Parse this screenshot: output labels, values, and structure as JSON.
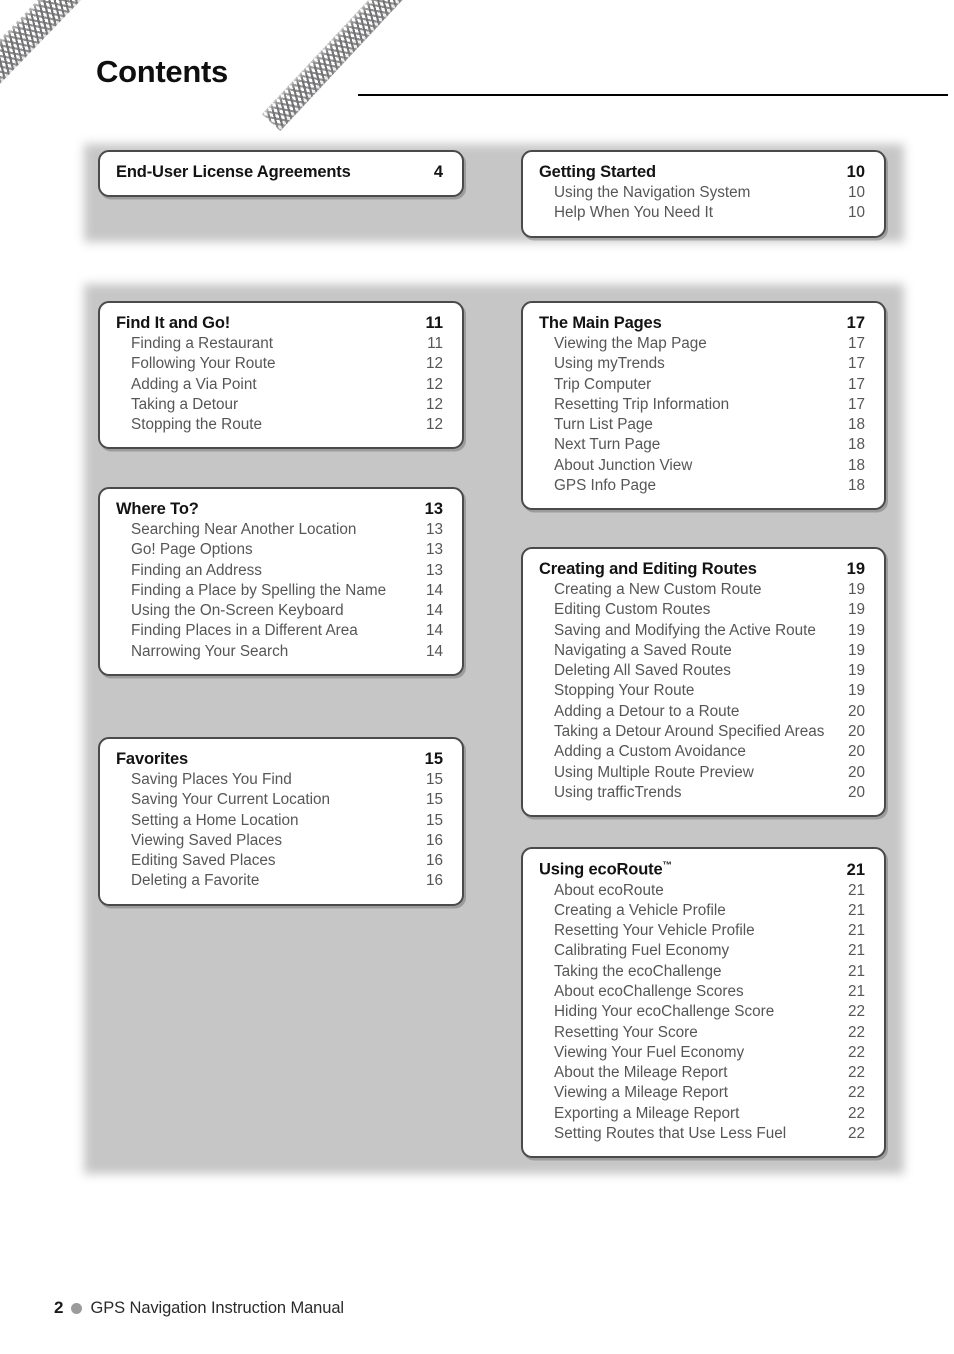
{
  "page": {
    "title": "Contents",
    "footer": {
      "page_number": "2",
      "manual_name": "GPS Navigation Instruction Manual"
    },
    "colors": {
      "panel_gray": "#c6c6c6",
      "box_border": "#4a4a4a",
      "heading_text": "#131313",
      "entry_text": "#565656",
      "footer_dot": "#9b9b9b"
    }
  },
  "toc": {
    "left_column": [
      {
        "heading": "End-User License Agreements",
        "page": "4",
        "entries": []
      },
      {
        "heading": "Find It and Go!",
        "page": "11",
        "entries": [
          {
            "label": "Finding a Restaurant",
            "page": "11"
          },
          {
            "label": "Following Your Route",
            "page": "12"
          },
          {
            "label": "Adding a Via Point",
            "page": "12"
          },
          {
            "label": "Taking a Detour",
            "page": "12"
          },
          {
            "label": "Stopping the Route",
            "page": "12"
          }
        ]
      },
      {
        "heading": "Where To?",
        "page": "13",
        "entries": [
          {
            "label": "Searching Near Another Location",
            "page": "13"
          },
          {
            "label": "Go! Page Options",
            "page": "13"
          },
          {
            "label": "Finding an Address",
            "page": "13"
          },
          {
            "label": "Finding a Place by Spelling the Name",
            "page": "14"
          },
          {
            "label": "Using the On-Screen Keyboard",
            "page": "14"
          },
          {
            "label": "Finding Places in a Different Area",
            "page": "14"
          },
          {
            "label": "Narrowing Your Search",
            "page": "14"
          }
        ]
      },
      {
        "heading": "Favorites",
        "page": "15",
        "entries": [
          {
            "label": "Saving Places You Find",
            "page": "15"
          },
          {
            "label": "Saving Your Current Location",
            "page": "15"
          },
          {
            "label": "Setting a Home Location",
            "page": "15"
          },
          {
            "label": "Viewing Saved Places",
            "page": "16"
          },
          {
            "label": "Editing Saved Places",
            "page": "16"
          },
          {
            "label": "Deleting a Favorite",
            "page": "16"
          }
        ]
      }
    ],
    "right_column": [
      {
        "heading": "Getting Started",
        "page": "10",
        "entries": [
          {
            "label": "Using the Navigation System",
            "page": "10"
          },
          {
            "label": "Help When You Need It",
            "page": "10"
          }
        ]
      },
      {
        "heading": "The Main Pages",
        "page": "17",
        "entries": [
          {
            "label": "Viewing the Map Page",
            "page": "17"
          },
          {
            "label": "Using myTrends",
            "page": "17"
          },
          {
            "label": "Trip Computer",
            "page": "17"
          },
          {
            "label": "Resetting Trip Information",
            "page": "17"
          },
          {
            "label": "Turn List Page",
            "page": "18"
          },
          {
            "label": "Next Turn Page",
            "page": "18"
          },
          {
            "label": "About Junction View",
            "page": "18"
          },
          {
            "label": "GPS Info Page",
            "page": "18"
          }
        ]
      },
      {
        "heading": "Creating and Editing Routes",
        "page": "19",
        "entries": [
          {
            "label": "Creating a New Custom Route",
            "page": "19"
          },
          {
            "label": "Editing Custom Routes",
            "page": "19"
          },
          {
            "label": "Saving and Modifying the Active Route",
            "page": "19"
          },
          {
            "label": "Navigating a Saved Route",
            "page": "19"
          },
          {
            "label": "Deleting All Saved Routes",
            "page": "19"
          },
          {
            "label": "Stopping Your Route",
            "page": "19"
          },
          {
            "label": "Adding a Detour to a Route",
            "page": "20"
          },
          {
            "label": "Taking a Detour Around Specified Areas",
            "page": "20"
          },
          {
            "label": "Adding a Custom Avoidance",
            "page": "20"
          },
          {
            "label": "Using Multiple Route Preview",
            "page": "20"
          },
          {
            "label": "Using trafficTrends",
            "page": "20"
          }
        ]
      },
      {
        "heading": "Using ecoRoute",
        "heading_superscript": "™",
        "page": "21",
        "entries": [
          {
            "label": "About ecoRoute",
            "page": "21"
          },
          {
            "label": "Creating a Vehicle Profile",
            "page": "21"
          },
          {
            "label": "Resetting Your Vehicle Profile",
            "page": "21"
          },
          {
            "label": "Calibrating Fuel Economy",
            "page": "21"
          },
          {
            "label": "Taking the ecoChallenge",
            "page": "21"
          },
          {
            "label": "About ecoChallenge Scores",
            "page": "21"
          },
          {
            "label": "Hiding Your ecoChallenge Score",
            "page": "22"
          },
          {
            "label": "Resetting Your Score",
            "page": "22"
          },
          {
            "label": "Viewing Your Fuel Economy",
            "page": "22"
          },
          {
            "label": "About the Mileage Report",
            "page": "22"
          },
          {
            "label": "Viewing a Mileage Report",
            "page": "22"
          },
          {
            "label": "Exporting a Mileage Report",
            "page": "22"
          },
          {
            "label": "Setting Routes that Use Less Fuel",
            "page": "22"
          }
        ]
      }
    ]
  },
  "layout": {
    "left_box_tops": [
      150,
      301,
      487,
      737
    ],
    "right_box_tops": [
      150,
      301,
      547,
      847
    ]
  }
}
